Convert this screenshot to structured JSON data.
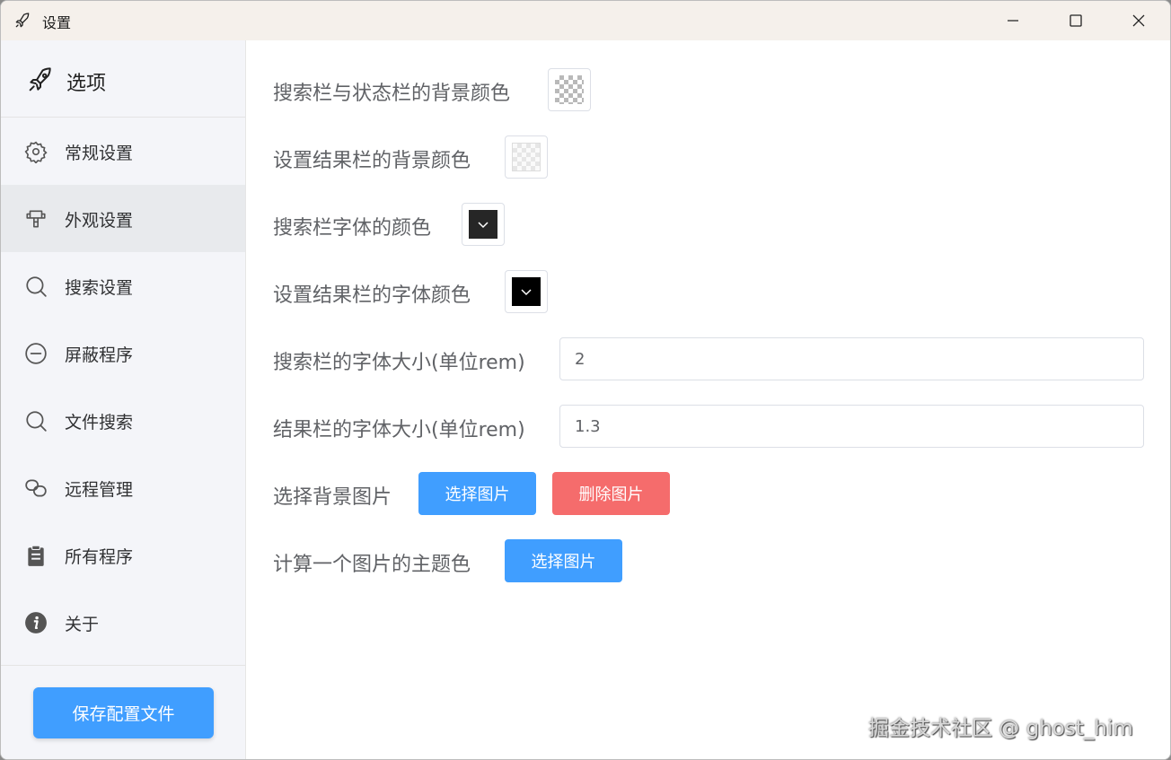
{
  "window": {
    "title": "设置"
  },
  "sidebar": {
    "header": "选项",
    "items": [
      {
        "label": "常规设置",
        "icon": "gear-icon"
      },
      {
        "label": "外观设置",
        "icon": "palette-icon",
        "active": true
      },
      {
        "label": "搜索设置",
        "icon": "search-icon"
      },
      {
        "label": "屏蔽程序",
        "icon": "minus-circle-icon"
      },
      {
        "label": "文件搜索",
        "icon": "search-icon"
      },
      {
        "label": "远程管理",
        "icon": "link-icon"
      },
      {
        "label": "所有程序",
        "icon": "clipboard-icon"
      },
      {
        "label": "关于",
        "icon": "info-icon"
      }
    ],
    "save_button": "保存配置文件"
  },
  "main": {
    "search_bar_bg_label": "搜索栏与状态栏的背景颜色",
    "result_bar_bg_label": "设置结果栏的背景颜色",
    "search_font_color_label": "搜索栏字体的颜色",
    "result_font_color_label": "设置结果栏的字体颜色",
    "search_font_size_label": "搜索栏的字体大小(单位rem)",
    "search_font_size_value": "2",
    "result_font_size_label": "结果栏的字体大小(单位rem)",
    "result_font_size_value": "1.3",
    "bg_image_label": "选择背景图片",
    "bg_image_select": "选择图片",
    "bg_image_delete": "删除图片",
    "theme_color_label": "计算一个图片的主题色",
    "theme_color_select": "选择图片"
  },
  "colors": {
    "primary": "#409eff",
    "danger": "#f56c6c",
    "search_font_color": "#262626",
    "result_font_color": "#000000"
  },
  "watermark": "掘金技术社区 @ ghost_him"
}
